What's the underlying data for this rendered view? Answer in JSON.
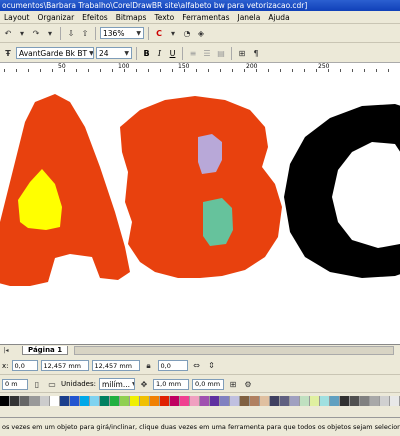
{
  "window": {
    "title": "ocumentos\\Barbara Trabalho\\CorelDrawBR site\\alfabeto bw para vetorizacao.cdr]"
  },
  "menu": [
    "Layout",
    "Organizar",
    "Efeitos",
    "Bitmaps",
    "Texto",
    "Ferramentas",
    "Janela",
    "Ajuda"
  ],
  "toolbar": {
    "zoom": "136%"
  },
  "text_toolbar": {
    "font": "AvantGarde Bk BT",
    "size": "24",
    "bold": "B",
    "italic": "I",
    "underline": "U"
  },
  "ruler": {
    "labels": [
      "50",
      "100",
      "150",
      "200",
      "250"
    ]
  },
  "page_tab": "Página 1",
  "property_bar": {
    "units_label": "Unidades:",
    "units_value": "milím...",
    "nudge": "1,0 mm",
    "dup_x": "0,0 mm",
    "dup_y": "0,0 mm",
    "x_val": "0,0",
    "w_val": "12,457 mm",
    "h_val": "12,457 mm",
    "left_small": "0 m",
    "left_small2": "0 m"
  },
  "palette": {
    "colors": [
      "#000000",
      "#333333",
      "#666666",
      "#999999",
      "#cccccc",
      "#ffffff",
      "#1a3e8c",
      "#2255d0",
      "#00a8e8",
      "#7fd3f0",
      "#008060",
      "#20b040",
      "#90d050",
      "#f0f000",
      "#f0c000",
      "#f08000",
      "#e02000",
      "#c00060",
      "#f04090",
      "#f0a0c0",
      "#a050b0",
      "#6030a0",
      "#8080c0",
      "#c0c0e0",
      "#806040",
      "#b08060",
      "#e0c0a0",
      "#404060",
      "#606080",
      "#a0a0c0",
      "#c0e0c0",
      "#e0f0a0",
      "#a0e0e0",
      "#60a0c0",
      "#303030",
      "#505050",
      "#808080",
      "#a8a8a8",
      "#d0d0d0",
      "#e8e8e8"
    ]
  },
  "status": "os vezes em um objeto para girá/inclinar, clique duas vezes em uma ferramenta para que todos os objetos sejam selecionados; clique c...",
  "letters": {
    "a_color": "#e8410e",
    "a_hole_color": "#ffff00",
    "b_color": "#e8410e",
    "b_top_hole_color": "#b8a8d8",
    "b_bottom_hole_color": "#66c29c",
    "c_color": "#000000"
  }
}
